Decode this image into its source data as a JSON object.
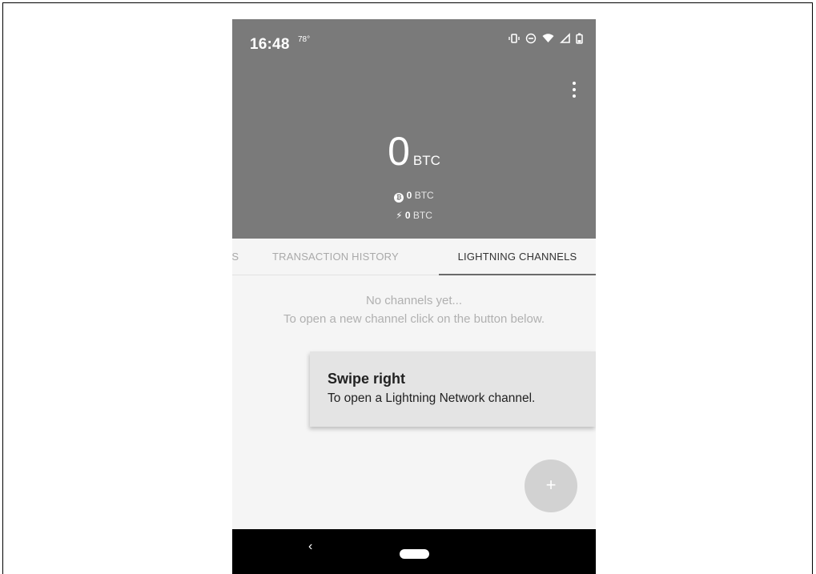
{
  "status_bar": {
    "time": "16:48",
    "temperature": "78°",
    "icons": [
      "vibrate-icon",
      "do-not-disturb-icon",
      "wifi-icon",
      "signal-icon",
      "battery-icon"
    ]
  },
  "menu": {
    "icon": "more-vert-icon"
  },
  "balance": {
    "total_value": "0",
    "total_unit": "BTC",
    "onchain_value": "0",
    "onchain_unit": "BTC",
    "lightning_value": "0",
    "lightning_unit": "BTC"
  },
  "tabs": [
    {
      "label": "RESS"
    },
    {
      "label": "TRANSACTION HISTORY"
    },
    {
      "label": "LIGHTNING CHANNELS",
      "selected": true
    }
  ],
  "empty_state": {
    "line1": "No channels yet...",
    "line2": "To open a new channel click on the button below."
  },
  "tooltip": {
    "title": "Swipe right",
    "body": "To open a Lightning Network channel."
  },
  "fab": {
    "label": "+"
  },
  "nav_bar": {
    "back_glyph": "‹"
  },
  "colors": {
    "header_bg": "#7a7a7a",
    "content_bg": "#f5f5f5",
    "tooltip_bg": "#e4e4e4",
    "fab_bg": "#d2d2d2"
  }
}
